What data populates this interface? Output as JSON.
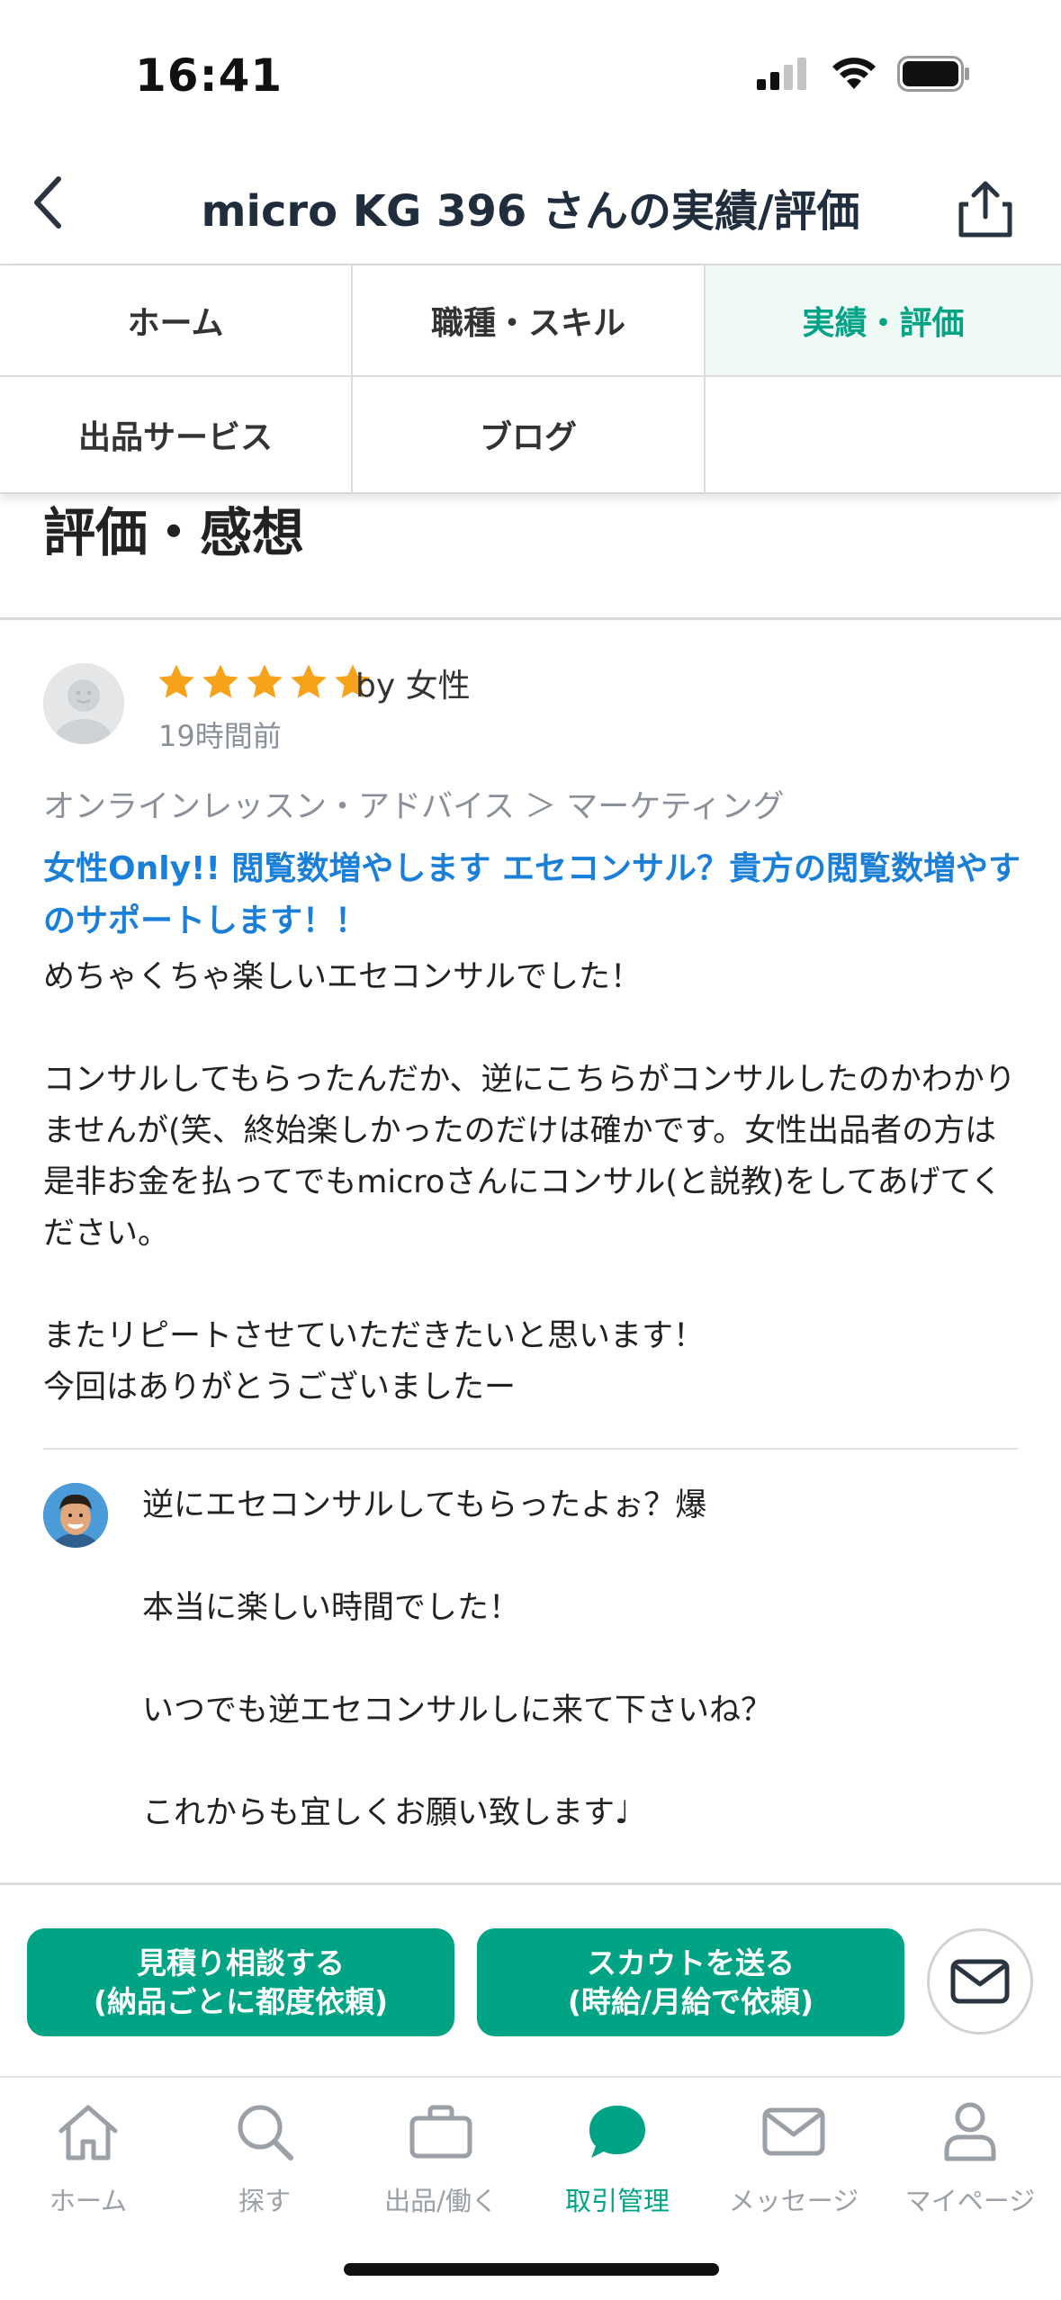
{
  "status_bar": {
    "time": "16:41"
  },
  "header": {
    "title": "micro KG 396 さんの実績/評価"
  },
  "tabs": [
    {
      "label": "ホーム",
      "active": false
    },
    {
      "label": "職種・スキル",
      "active": false
    },
    {
      "label": "実績・評価",
      "active": true
    },
    {
      "label": "出品サービス",
      "active": false
    },
    {
      "label": "ブログ",
      "active": false
    }
  ],
  "section": {
    "title": "評価・感想"
  },
  "review": {
    "rating": 5,
    "reviewer": "by 女性",
    "time_ago": "19時間前",
    "category": "オンラインレッスン・アドバイス ＞ マーケティング",
    "service_title": "女性Only!! 閲覧数増やします エセコンサル？貴方の閲覧数増やすのサポートします！！",
    "body": "めちゃくちゃ楽しいエセコンサルでした！\n\nコンサルしてもらったんだか、逆にこちらがコンサルしたのかわかりませんが(笑、終始楽しかったのだけは確かです。女性出品者の方は是非お金を払ってでもmicroさんにコンサル(と説教)をしてあげてください。\n\nまたリピートさせていただきたいと思います！\n今回はありがとうございましたー"
  },
  "reply": {
    "body": "逆にエセコンサルしてもらったよぉ？爆\n\n本当に楽しい時間でした！\n\nいつでも逆エセコンサルしに来て下さいね？\n\nこれからも宜しくお願い致します♩"
  },
  "actions": {
    "estimate_line1": "見積り相談する",
    "estimate_line2": "(納品ごとに都度依頼)",
    "scout_line1": "スカウトを送る",
    "scout_line2": "(時給/月給で依頼)"
  },
  "tabbar": [
    {
      "label": "ホーム",
      "icon": "home-icon",
      "active": false
    },
    {
      "label": "探す",
      "icon": "search-icon",
      "active": false
    },
    {
      "label": "出品/働く",
      "icon": "briefcase-icon",
      "active": false
    },
    {
      "label": "取引管理",
      "icon": "chat-bubble-icon",
      "active": true
    },
    {
      "label": "メッセージ",
      "icon": "mail-icon",
      "active": false
    },
    {
      "label": "マイページ",
      "icon": "person-icon",
      "active": false
    }
  ],
  "colors": {
    "accent": "#00a383",
    "link": "#1a7fd8",
    "star": "#f7a21b"
  }
}
